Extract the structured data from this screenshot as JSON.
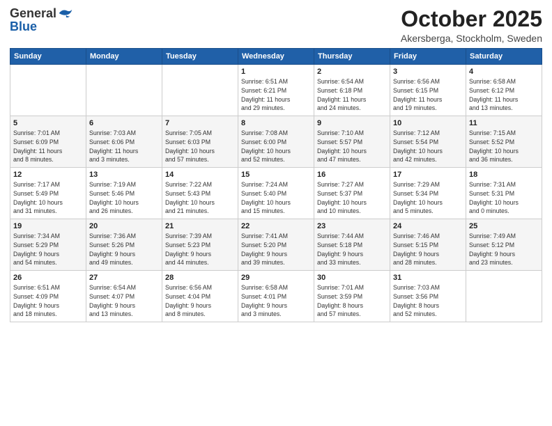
{
  "header": {
    "logo_general": "General",
    "logo_blue": "Blue",
    "month": "October 2025",
    "location": "Akersberga, Stockholm, Sweden"
  },
  "weekdays": [
    "Sunday",
    "Monday",
    "Tuesday",
    "Wednesday",
    "Thursday",
    "Friday",
    "Saturday"
  ],
  "rows": [
    [
      {
        "day": "",
        "info": ""
      },
      {
        "day": "",
        "info": ""
      },
      {
        "day": "",
        "info": ""
      },
      {
        "day": "1",
        "info": "Sunrise: 6:51 AM\nSunset: 6:21 PM\nDaylight: 11 hours\nand 29 minutes."
      },
      {
        "day": "2",
        "info": "Sunrise: 6:54 AM\nSunset: 6:18 PM\nDaylight: 11 hours\nand 24 minutes."
      },
      {
        "day": "3",
        "info": "Sunrise: 6:56 AM\nSunset: 6:15 PM\nDaylight: 11 hours\nand 19 minutes."
      },
      {
        "day": "4",
        "info": "Sunrise: 6:58 AM\nSunset: 6:12 PM\nDaylight: 11 hours\nand 13 minutes."
      }
    ],
    [
      {
        "day": "5",
        "info": "Sunrise: 7:01 AM\nSunset: 6:09 PM\nDaylight: 11 hours\nand 8 minutes."
      },
      {
        "day": "6",
        "info": "Sunrise: 7:03 AM\nSunset: 6:06 PM\nDaylight: 11 hours\nand 3 minutes."
      },
      {
        "day": "7",
        "info": "Sunrise: 7:05 AM\nSunset: 6:03 PM\nDaylight: 10 hours\nand 57 minutes."
      },
      {
        "day": "8",
        "info": "Sunrise: 7:08 AM\nSunset: 6:00 PM\nDaylight: 10 hours\nand 52 minutes."
      },
      {
        "day": "9",
        "info": "Sunrise: 7:10 AM\nSunset: 5:57 PM\nDaylight: 10 hours\nand 47 minutes."
      },
      {
        "day": "10",
        "info": "Sunrise: 7:12 AM\nSunset: 5:54 PM\nDaylight: 10 hours\nand 42 minutes."
      },
      {
        "day": "11",
        "info": "Sunrise: 7:15 AM\nSunset: 5:52 PM\nDaylight: 10 hours\nand 36 minutes."
      }
    ],
    [
      {
        "day": "12",
        "info": "Sunrise: 7:17 AM\nSunset: 5:49 PM\nDaylight: 10 hours\nand 31 minutes."
      },
      {
        "day": "13",
        "info": "Sunrise: 7:19 AM\nSunset: 5:46 PM\nDaylight: 10 hours\nand 26 minutes."
      },
      {
        "day": "14",
        "info": "Sunrise: 7:22 AM\nSunset: 5:43 PM\nDaylight: 10 hours\nand 21 minutes."
      },
      {
        "day": "15",
        "info": "Sunrise: 7:24 AM\nSunset: 5:40 PM\nDaylight: 10 hours\nand 15 minutes."
      },
      {
        "day": "16",
        "info": "Sunrise: 7:27 AM\nSunset: 5:37 PM\nDaylight: 10 hours\nand 10 minutes."
      },
      {
        "day": "17",
        "info": "Sunrise: 7:29 AM\nSunset: 5:34 PM\nDaylight: 10 hours\nand 5 minutes."
      },
      {
        "day": "18",
        "info": "Sunrise: 7:31 AM\nSunset: 5:31 PM\nDaylight: 10 hours\nand 0 minutes."
      }
    ],
    [
      {
        "day": "19",
        "info": "Sunrise: 7:34 AM\nSunset: 5:29 PM\nDaylight: 9 hours\nand 54 minutes."
      },
      {
        "day": "20",
        "info": "Sunrise: 7:36 AM\nSunset: 5:26 PM\nDaylight: 9 hours\nand 49 minutes."
      },
      {
        "day": "21",
        "info": "Sunrise: 7:39 AM\nSunset: 5:23 PM\nDaylight: 9 hours\nand 44 minutes."
      },
      {
        "day": "22",
        "info": "Sunrise: 7:41 AM\nSunset: 5:20 PM\nDaylight: 9 hours\nand 39 minutes."
      },
      {
        "day": "23",
        "info": "Sunrise: 7:44 AM\nSunset: 5:18 PM\nDaylight: 9 hours\nand 33 minutes."
      },
      {
        "day": "24",
        "info": "Sunrise: 7:46 AM\nSunset: 5:15 PM\nDaylight: 9 hours\nand 28 minutes."
      },
      {
        "day": "25",
        "info": "Sunrise: 7:49 AM\nSunset: 5:12 PM\nDaylight: 9 hours\nand 23 minutes."
      }
    ],
    [
      {
        "day": "26",
        "info": "Sunrise: 6:51 AM\nSunset: 4:09 PM\nDaylight: 9 hours\nand 18 minutes."
      },
      {
        "day": "27",
        "info": "Sunrise: 6:54 AM\nSunset: 4:07 PM\nDaylight: 9 hours\nand 13 minutes."
      },
      {
        "day": "28",
        "info": "Sunrise: 6:56 AM\nSunset: 4:04 PM\nDaylight: 9 hours\nand 8 minutes."
      },
      {
        "day": "29",
        "info": "Sunrise: 6:58 AM\nSunset: 4:01 PM\nDaylight: 9 hours\nand 3 minutes."
      },
      {
        "day": "30",
        "info": "Sunrise: 7:01 AM\nSunset: 3:59 PM\nDaylight: 8 hours\nand 57 minutes."
      },
      {
        "day": "31",
        "info": "Sunrise: 7:03 AM\nSunset: 3:56 PM\nDaylight: 8 hours\nand 52 minutes."
      },
      {
        "day": "",
        "info": ""
      }
    ]
  ]
}
